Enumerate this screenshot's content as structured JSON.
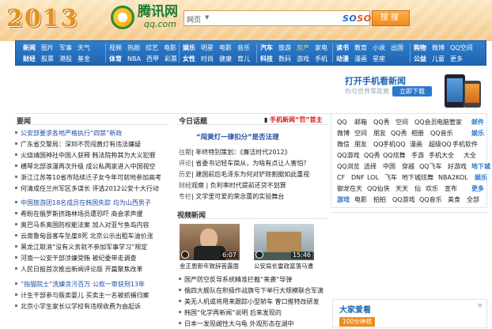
{
  "header": {
    "logo_year": "2013",
    "brand_cn": "腾讯网",
    "brand_en": "qq.com",
    "search_category": "网页",
    "search_placeholder": "",
    "soso_a": "SO",
    "soso_b": "SO",
    "search_button": "搜搜"
  },
  "nav": [
    {
      "rows": [
        [
          "新闻",
          "图片",
          "军事",
          "天气"
        ],
        [
          "财经",
          "股票",
          "港股",
          "基金"
        ]
      ],
      "key": [
        0
      ]
    },
    {
      "rows": [
        [
          "体育",
          "NBA",
          "西甲",
          "彩票"
        ],
        [
          "视频",
          "热剧",
          "综艺",
          "电影"
        ]
      ],
      "key": [
        0
      ]
    },
    {
      "rows": [
        [
          "娱乐",
          "明星",
          "电影",
          "音乐"
        ],
        [
          "女性",
          "时尚",
          "健康",
          "育儿"
        ]
      ],
      "key": [
        0
      ]
    },
    {
      "rows": [
        [
          "汽车",
          "旅游",
          "房产",
          "家电"
        ],
        [
          "科技",
          "数码",
          "游戏",
          "手机"
        ]
      ],
      "key": [
        0
      ]
    },
    {
      "rows": [
        [
          "读书",
          "教育",
          "小说",
          "出国"
        ],
        [
          "动漫",
          "动漫",
          "漫画",
          "星座"
        ]
      ],
      "key": [
        0
      ]
    },
    {
      "rows": [
        [
          "购物",
          "微博",
          "QQ空间"
        ],
        [
          "公益",
          "儿童",
          "更多"
        ]
      ],
      "key": [
        0
      ]
    }
  ],
  "promo": {
    "title": "打开手机看新闻",
    "subtitle": "你与世界零距离",
    "button": "立即下载"
  },
  "news": {
    "heading": "要闻",
    "items": [
      {
        "text": "公安部要求各地严格执行“四禁”新政",
        "lead": true
      },
      {
        "text": "广东省交警局：深圳不罚闯黄灯有违法嫌疑",
        "lead": false
      },
      {
        "text": "火烧靖国神社中国人获释 韩法院称其为大义犯罪",
        "lead": false
      },
      {
        "text": "横琴北部浪漫再次升级 成公私两家进入中国视空",
        "lead": false
      },
      {
        "text": "浙江江苏等10省市陆续迁子女今年可就地参加高考",
        "lead": false
      },
      {
        "text": "何清成任兰州军区多谋长 评选2012公安十大行动",
        "lead": false
      },
      {
        "text": "中国旅游团18名成员在韩国失踪 均为山西男子",
        "lead": true
      },
      {
        "text": "希盼在俄罗斯挤路林场员遭恐吓 商会求声援",
        "lead": false
      },
      {
        "text": "奥巴马系奥国防权能法案 加入对亚兮鱼岛内容",
        "lead": false
      },
      {
        "text": "云南鲁甸县客车坠崖8死 北京公示出租车油价涨",
        "lead": false
      },
      {
        "text": "黑龙江取消“没有义务就不参加军事学习”规定",
        "lead": false
      },
      {
        "text": "河南一公安干部涉嫌受贿 被纪委带走调查",
        "lead": false
      },
      {
        "text": "人民日报首次推出新闻评论版 开篇聚焦改革",
        "lead": false
      },
      {
        "text": "“指猫院士”洗嫌贪污百万 公款一审获刑13年",
        "lead": true
      },
      {
        "text": "计生干部参与贩卖婴儿 买卖主一名被抓捕归案",
        "lead": false
      },
      {
        "text": "北京小学生家长以学校有违规收费为由起诉",
        "lead": false
      }
    ]
  },
  "topics": {
    "heading": "今日话题",
    "red_a": "手机新闻“罚”首主",
    "spotlight": "“闯黄灯一律扣分”是否法理",
    "lines": [
      {
        "tag": "往期",
        "text": "| 年终特别策划：《廉洁时代2012》"
      },
      {
        "tag": "评论",
        "text": "| 省委书记轻车简从，为啥有点让人害怕？"
      },
      {
        "tag": "历史",
        "text": "| 建国前后毛泽东为何对铲除割据如此重视"
      },
      {
        "tag": "财经",
        "text": "观察 | 负利率时代提前还贷不划算"
      },
      {
        "tag": "专栏",
        "text": "| 文学里可爱的荣念蕾的实验舞台"
      }
    ]
  },
  "video": {
    "heading": "视频新闻",
    "thumbs": [
      {
        "caption": "金正恩新年致辞首露面",
        "duration": "6:07"
      },
      {
        "caption": "公安局长雷政富落马遭",
        "duration": "15:46"
      }
    ],
    "lines": [
      "国产防空反导系统精准拦截“来袭”导弹",
      "俄四大舰队在积极作战旗号下举行大规模联合军演",
      "美无人机或将用来跟踪小型轿车 曾口推特改研发",
      "韩国“化学再新闻”说明 后来发现的",
      "日本一发现雌性大乌龟 外观形态在湖中"
    ]
  },
  "links": [
    [
      "QQ",
      "邮箱",
      "QQ秀",
      "空间",
      "QQ会员",
      "电脑管家",
      "邮件"
    ],
    [
      "微博",
      "空间",
      "朋友",
      "QQ秀",
      "相册",
      "QQ音乐",
      "娱乐"
    ],
    [
      "微信",
      "朋友",
      "QQ",
      "手机QQ",
      "漫画",
      "超级QQ",
      "手机软件",
      "手机"
    ],
    [
      "QQ游戏",
      "QQ秀",
      "QQ炫舞",
      "手游",
      "手机大全",
      "QQ门",
      "大全"
    ],
    [
      "QQ浏览",
      "选择",
      "中国",
      "穿越",
      "QQ飞车",
      "好游戏",
      "地下城"
    ],
    [
      "CF",
      "DNF",
      "LOL",
      "飞车",
      "地下城",
      "炫舞",
      "NBA2KOL",
      "娱乐"
    ],
    [
      "御龙在天",
      "QQ仙侠",
      "天天",
      "仙",
      "欢乐",
      "宣布",
      "更多"
    ],
    [
      "游戏",
      "电影",
      "拍拍",
      "QQ游戏",
      "QQ音乐",
      "美食",
      "全部"
    ]
  ],
  "love": {
    "title": "大家爱看",
    "badge": "100分神视",
    "close": "×"
  }
}
